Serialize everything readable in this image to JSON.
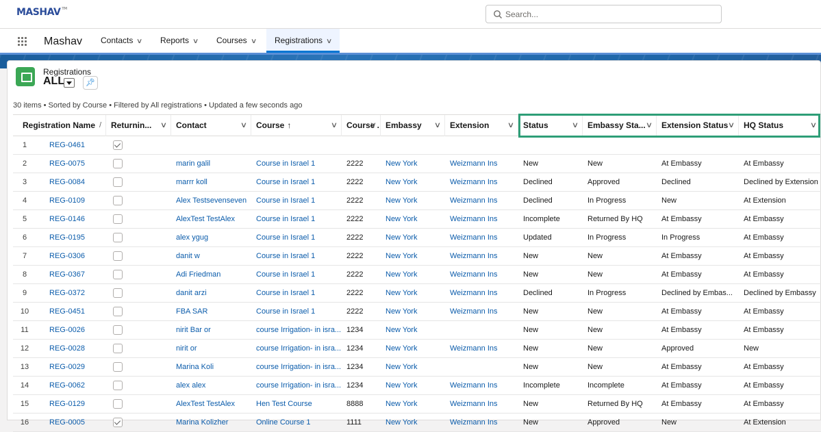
{
  "header": {
    "logo_text": "MASHAV",
    "logo_tm": "TM",
    "search_placeholder": "Search..."
  },
  "nav": {
    "app_name": "Mashav",
    "items": [
      {
        "label": "Contacts",
        "active": false
      },
      {
        "label": "Reports",
        "active": false
      },
      {
        "label": "Courses",
        "active": false
      },
      {
        "label": "Registrations",
        "active": true
      }
    ]
  },
  "list_view": {
    "object_label": "Registrations",
    "view_name": "ALL",
    "meta": "30 items • Sorted by Course • Filtered by All registrations • Updated a few seconds ago"
  },
  "table": {
    "columns": [
      {
        "label": "Registration Name",
        "sort": "",
        "has_menu": false
      },
      {
        "label": "Returnin...",
        "sort": "",
        "has_menu": true
      },
      {
        "label": "Contact",
        "sort": "",
        "has_menu": true
      },
      {
        "label": "Course",
        "sort": "↑",
        "has_menu": true
      },
      {
        "label": "Course .",
        "sort": "",
        "has_menu": true
      },
      {
        "label": "Embassy",
        "sort": "",
        "has_menu": true
      },
      {
        "label": "Extension",
        "sort": "",
        "has_menu": true
      },
      {
        "label": "Status",
        "sort": "",
        "has_menu": true
      },
      {
        "label": "Embassy Sta...",
        "sort": "",
        "has_menu": true
      },
      {
        "label": "Extension Status",
        "sort": "",
        "has_menu": true
      },
      {
        "label": "HQ Status",
        "sort": "",
        "has_menu": true
      }
    ],
    "rows": [
      {
        "num": "1",
        "name": "REG-0461",
        "returning": true,
        "contact": "",
        "course": "",
        "code": "",
        "embassy": "",
        "extension": "",
        "status": "",
        "embassy_status": "",
        "extension_status": "",
        "hq_status": ""
      },
      {
        "num": "2",
        "name": "REG-0075",
        "returning": false,
        "contact": "marin galil",
        "course": "Course in Israel 1",
        "code": "2222",
        "embassy": "New York",
        "extension": "Weizmann Ins",
        "status": "New",
        "embassy_status": "New",
        "extension_status": "At Embassy",
        "hq_status": "At Embassy"
      },
      {
        "num": "3",
        "name": "REG-0084",
        "returning": false,
        "contact": "marrr koll",
        "course": "Course in Israel 1",
        "code": "2222",
        "embassy": "New York",
        "extension": "Weizmann Ins",
        "status": "Declined",
        "embassy_status": "Approved",
        "extension_status": "Declined",
        "hq_status": "Declined by Extension"
      },
      {
        "num": "4",
        "name": "REG-0109",
        "returning": false,
        "contact": "Alex Testsevenseven",
        "course": "Course in Israel 1",
        "code": "2222",
        "embassy": "New York",
        "extension": "Weizmann Ins",
        "status": "Declined",
        "embassy_status": "In Progress",
        "extension_status": "New",
        "hq_status": "At Extension"
      },
      {
        "num": "5",
        "name": "REG-0146",
        "returning": false,
        "contact": "AlexTest TestAlex",
        "course": "Course in Israel 1",
        "code": "2222",
        "embassy": "New York",
        "extension": "Weizmann Ins",
        "status": "Incomplete",
        "embassy_status": "Returned By HQ",
        "extension_status": "At Embassy",
        "hq_status": "At Embassy"
      },
      {
        "num": "6",
        "name": "REG-0195",
        "returning": false,
        "contact": "alex ygug",
        "course": "Course in Israel 1",
        "code": "2222",
        "embassy": "New York",
        "extension": "Weizmann Ins",
        "status": "Updated",
        "embassy_status": "In Progress",
        "extension_status": "In Progress",
        "hq_status": "At Embassy"
      },
      {
        "num": "7",
        "name": "REG-0306",
        "returning": false,
        "contact": "danit w",
        "course": "Course in Israel 1",
        "code": "2222",
        "embassy": "New York",
        "extension": "Weizmann Ins",
        "status": "New",
        "embassy_status": "New",
        "extension_status": "At Embassy",
        "hq_status": "At Embassy"
      },
      {
        "num": "8",
        "name": "REG-0367",
        "returning": false,
        "contact": "Adi Friedman",
        "course": "Course in Israel 1",
        "code": "2222",
        "embassy": "New York",
        "extension": "Weizmann Ins",
        "status": "New",
        "embassy_status": "New",
        "extension_status": "At Embassy",
        "hq_status": "At Embassy"
      },
      {
        "num": "9",
        "name": "REG-0372",
        "returning": false,
        "contact": "danit arzi",
        "course": "Course in Israel 1",
        "code": "2222",
        "embassy": "New York",
        "extension": "Weizmann Ins",
        "status": "Declined",
        "embassy_status": "In Progress",
        "extension_status": "Declined by Embas...",
        "hq_status": "Declined by Embassy"
      },
      {
        "num": "10",
        "name": "REG-0451",
        "returning": false,
        "contact": "FBA SAR",
        "course": "Course in Israel 1",
        "code": "2222",
        "embassy": "New York",
        "extension": "Weizmann Ins",
        "status": "New",
        "embassy_status": "New",
        "extension_status": "At Embassy",
        "hq_status": "At Embassy"
      },
      {
        "num": "11",
        "name": "REG-0026",
        "returning": false,
        "contact": "nirit Bar or",
        "course": "course Irrigation- in isra...",
        "code": "1234",
        "embassy": "New York",
        "extension": "",
        "status": "New",
        "embassy_status": "New",
        "extension_status": "At Embassy",
        "hq_status": "At Embassy"
      },
      {
        "num": "12",
        "name": "REG-0028",
        "returning": false,
        "contact": "nirit or",
        "course": "course Irrigation- in isra...",
        "code": "1234",
        "embassy": "New York",
        "extension": "Weizmann Ins",
        "status": "New",
        "embassy_status": "New",
        "extension_status": "Approved",
        "hq_status": "New"
      },
      {
        "num": "13",
        "name": "REG-0029",
        "returning": false,
        "contact": "Marina Koli",
        "course": "course Irrigation- in isra...",
        "code": "1234",
        "embassy": "New York",
        "extension": "",
        "status": "New",
        "embassy_status": "New",
        "extension_status": "At Embassy",
        "hq_status": "At Embassy"
      },
      {
        "num": "14",
        "name": "REG-0062",
        "returning": false,
        "contact": "alex alex",
        "course": "course Irrigation- in isra...",
        "code": "1234",
        "embassy": "New York",
        "extension": "Weizmann Ins",
        "status": "Incomplete",
        "embassy_status": "Incomplete",
        "extension_status": "At Embassy",
        "hq_status": "At Embassy"
      },
      {
        "num": "15",
        "name": "REG-0129",
        "returning": false,
        "contact": "AlexTest TestAlex",
        "course": "Hen Test Course",
        "code": "8888",
        "embassy": "New York",
        "extension": "Weizmann Ins",
        "status": "New",
        "embassy_status": "Returned By HQ",
        "extension_status": "At Embassy",
        "hq_status": "At Embassy"
      },
      {
        "num": "16",
        "name": "REG-0005",
        "returning": true,
        "contact": "Marina Kolizher",
        "course": "Online Course 1",
        "code": "1111",
        "embassy": "New York",
        "extension": "Weizmann Ins",
        "status": "New",
        "embassy_status": "Approved",
        "extension_status": "New",
        "hq_status": "At Extension"
      }
    ]
  },
  "colors": {
    "link": "#0b5cab",
    "highlight": "#2e9e77",
    "object_icon": "#3ba755",
    "nav_active": "#0176d3"
  },
  "icons": [
    "search-icon",
    "waffle-icon",
    "registrations-object-icon",
    "pin-icon",
    "chevron-down-icon",
    "checkbox-icon"
  ]
}
